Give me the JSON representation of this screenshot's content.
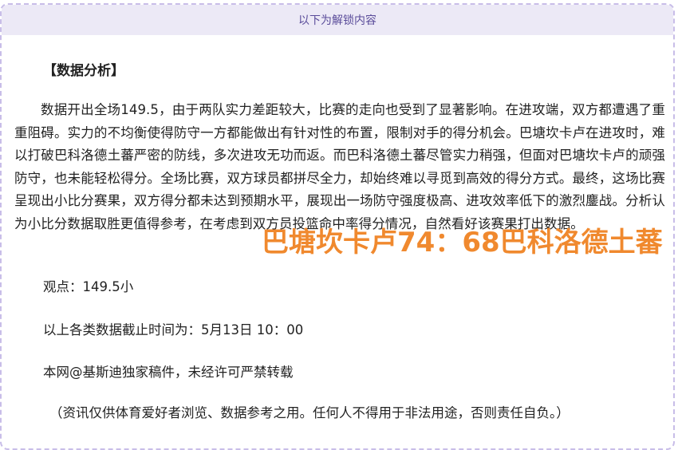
{
  "banner": {
    "text": "以下为解锁内容"
  },
  "article": {
    "heading": "【数据分析】",
    "paragraph": "数据开出全场149.5，由于两队实力差距较大，比赛的走向也受到了显著影响。在进攻端，双方都遭遇了重重阻碍。实力的不均衡使得防守一方都能做出有针对性的布置，限制对手的得分机会。巴塘坎卡卢在进攻时，难以打破巴科洛德土蕃严密的防线，多次进攻无功而返。而巴科洛德土蕃尽管实力稍强，但面对巴塘坎卡卢的顽强防守，也未能轻松得分。全场比赛，双方球员都拼尽全力，却始终难以寻觅到高效的得分方式。最终，这场比赛呈现出小比分赛果，双方得分都未达到预期水平，展现出一场防守强度极高、进攻效率低下的激烈鏖战。分析认为小比分数据取胜更值得参考，在考虑到双方员投篮命中率得分情况，自然看好该赛果打出数据。",
    "viewpoint": "观点：149.5小",
    "cutoff": "以上各类数据截止时间为：5月13日 10：00",
    "copyright": "本网@基斯迪独家稿件，未经许可严禁转载",
    "disclaimer": "（资讯仅供体育爱好者浏览、数据参考之用。任何人不得用于非法用途，否则责任自负。）"
  },
  "score_overlay": {
    "text": "巴塘坎卡卢74：68巴科洛德土蕃",
    "color": "#f0892e"
  }
}
